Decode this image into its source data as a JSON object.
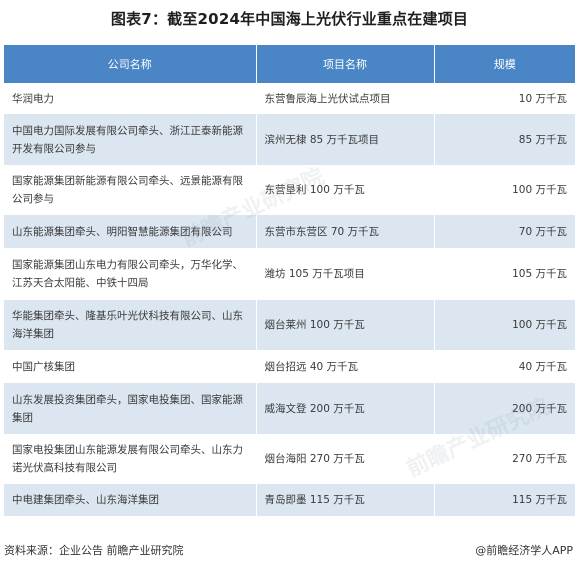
{
  "title": "图表7：截至2024年中国海上光伏行业重点在建项目",
  "table": {
    "headers": [
      "公司名称",
      "项目名称",
      "规模"
    ],
    "rows": [
      {
        "company": "华润电力",
        "project": "东营鲁辰海上光伏试点项目",
        "scale": "10 万千瓦"
      },
      {
        "company": "中国电力国际发展有限公司牵头、浙江正泰新能源开发有限公司参与",
        "project": "滨州无棣 85 万千瓦项目",
        "scale": "85 万千瓦"
      },
      {
        "company": "国家能源集团新能源有限公司牵头、远景能源有限公司参与",
        "project": "东营垦利 100 万千瓦",
        "scale": "100 万千瓦"
      },
      {
        "company": "山东能源集团牵头、明阳智慧能源集团有限公司",
        "project": "东营市东营区 70 万千瓦",
        "scale": "70 万千瓦"
      },
      {
        "company": "国家能源集团山东电力有限公司牵头，万华化学、江苏天合太阳能、中铁十四局",
        "project": "潍坊 105 万千瓦项目",
        "scale": "105 万千瓦"
      },
      {
        "company": "华能集团牵头、隆基乐叶光伏科技有限公司、山东海洋集团",
        "project": "烟台莱州 100 万千瓦",
        "scale": "100 万千瓦"
      },
      {
        "company": "中国广核集团",
        "project": "烟台招远 40 万千瓦",
        "scale": "40 万千瓦"
      },
      {
        "company": "山东发展投资集团牵头，国家电投集团、国家能源集团",
        "project": "威海文登 200 万千瓦",
        "scale": "200 万千瓦"
      },
      {
        "company": "国家电投集团山东能源发展有限公司牵头、山东力诺光伏高科技有限公司",
        "project": "烟台海阳 270 万千瓦",
        "scale": "270 万千瓦"
      },
      {
        "company": "中电建集团牵头、山东海洋集团",
        "project": "青岛即墨 115 万千瓦",
        "scale": "115 万千瓦"
      }
    ]
  },
  "footer": {
    "source": "资料来源：企业公告 前瞻产业研究院",
    "brand": "@前瞻经济学人APP"
  },
  "watermark": "前瞻产业研究院",
  "colors": {
    "header_bg": "#4a86c6",
    "stripe": "#dbe6f1"
  }
}
